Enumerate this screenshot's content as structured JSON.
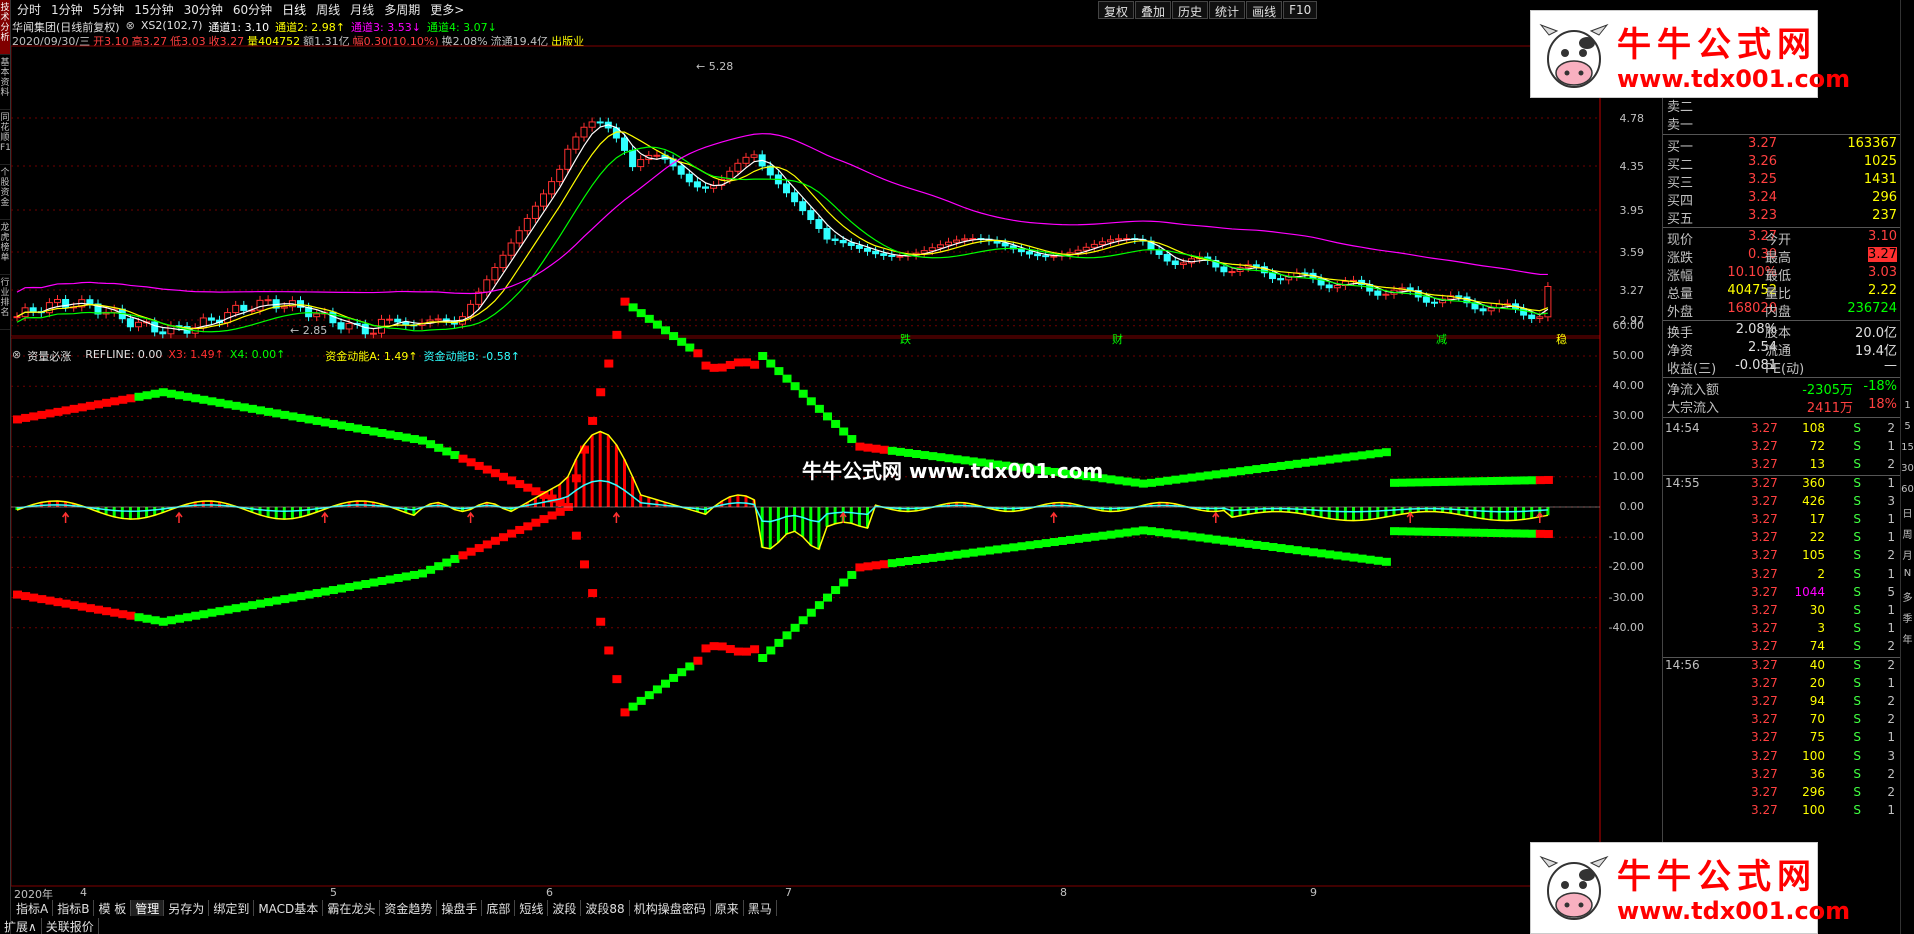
{
  "toolbar": {
    "tabs": [
      "分时",
      "1分钟",
      "5分钟",
      "15分钟",
      "30分钟",
      "60分钟",
      "日线",
      "周线",
      "月线",
      "多周期",
      "更多>"
    ],
    "right_buttons": [
      "复权",
      "叠加",
      "历史",
      "统计",
      "画线",
      "F10"
    ]
  },
  "left_tabs": [
    "技术分析",
    "基本资料",
    "同花顺F10",
    "个股资金",
    "龙虎榜单",
    "行业排名"
  ],
  "main_info": {
    "stock": "华闻集团(日线前复权)",
    "indicator": "XS2(102,7)",
    "ch1": "通道1: 3.10",
    "ch2": "通道2: 2.98↑",
    "ch3": "通道3: 3.53↓",
    "ch4": "通道4: 3.07↓"
  },
  "ohlc_line": {
    "date": "2020/09/30/三",
    "open": "开3.10",
    "high": "高3.27",
    "low": "低3.03",
    "close": "收3.27",
    "vol": "量404752",
    "amount": "额1.31亿",
    "change": "幅0.30(10.10%)",
    "turnover": "换2.08%",
    "float": "流通19.4亿",
    "industry": "出版业"
  },
  "price_axis": [
    "4.78",
    "4.35",
    "3.95",
    "3.59",
    "3.27",
    "2.97"
  ],
  "price_marks": {
    "high": "5.28",
    "low": "2.85"
  },
  "event_marks": [
    "跌",
    "财",
    "减",
    "稳"
  ],
  "sub_info": {
    "name": "资量必涨",
    "refline": "REFLINE: 0.00",
    "x3": "X3: 1.49↑",
    "x4": "X4: 0.00↑",
    "a": "资金动能A: 1.49↑",
    "b": "资金动能B: -0.58↑"
  },
  "sub_axis": [
    "60.00",
    "50.00",
    "40.00",
    "30.00",
    "20.00",
    "10.00",
    "0.00",
    "-10.00",
    "-20.00",
    "-30.00",
    "-40.00"
  ],
  "date_axis": [
    "2020年",
    "4",
    "5",
    "6",
    "7",
    "8",
    "9"
  ],
  "center_watermark": "牛牛公式网 www.tdx001.com",
  "watermark": {
    "title": "牛牛公式网",
    "url": "www.tdx001.com"
  },
  "quote": {
    "asks": [
      [
        "卖二",
        "",
        ""
      ],
      [
        "卖二",
        "",
        ""
      ],
      [
        "卖一",
        "",
        ""
      ]
    ],
    "bids": [
      [
        "买一",
        "3.27",
        "163367"
      ],
      [
        "买二",
        "3.26",
        "1025"
      ],
      [
        "买三",
        "3.25",
        "1431"
      ],
      [
        "买四",
        "3.24",
        "296"
      ],
      [
        "买五",
        "3.23",
        "237"
      ]
    ],
    "stats": [
      [
        "现价",
        "3.27",
        "今开",
        "3.10"
      ],
      [
        "涨跌",
        "0.30",
        "最高",
        "3.27"
      ],
      [
        "涨幅",
        "10.10%",
        "最低",
        "3.03"
      ],
      [
        "总量",
        "404752",
        "量比",
        "2.22"
      ],
      [
        "外盘",
        "168020",
        "内盘",
        "236724"
      ]
    ],
    "stats2": [
      [
        "换手",
        "2.08%",
        "股本",
        "20.0亿"
      ],
      [
        "净资",
        "2.54",
        "流通",
        "19.4亿"
      ],
      [
        "收益(三)",
        "-0.081",
        "PE(动)",
        "—"
      ]
    ],
    "flows": [
      [
        "净流入额",
        "-2305万",
        "-18%"
      ],
      [
        "大宗流入",
        "2411万",
        "18%"
      ]
    ]
  },
  "ticks": [
    [
      "14:54",
      "3.27",
      "108",
      "S",
      "2"
    ],
    [
      "",
      "3.27",
      "72",
      "S",
      "1"
    ],
    [
      "",
      "3.27",
      "13",
      "S",
      "2"
    ],
    [
      "14:55",
      "3.27",
      "360",
      "S",
      "1"
    ],
    [
      "",
      "3.27",
      "426",
      "S",
      "3"
    ],
    [
      "",
      "3.27",
      "17",
      "S",
      "1"
    ],
    [
      "",
      "3.27",
      "22",
      "S",
      "1"
    ],
    [
      "",
      "3.27",
      "105",
      "S",
      "2"
    ],
    [
      "",
      "3.27",
      "2",
      "S",
      "1"
    ],
    [
      "",
      "3.27",
      "1044",
      "S",
      "5"
    ],
    [
      "",
      "3.27",
      "30",
      "S",
      "1"
    ],
    [
      "",
      "3.27",
      "3",
      "S",
      "1"
    ],
    [
      "",
      "3.27",
      "74",
      "S",
      "2"
    ],
    [
      "14:56",
      "3.27",
      "40",
      "S",
      "2"
    ],
    [
      "",
      "3.27",
      "20",
      "S",
      "1"
    ],
    [
      "",
      "3.27",
      "94",
      "S",
      "2"
    ],
    [
      "",
      "3.27",
      "70",
      "S",
      "2"
    ],
    [
      "",
      "3.27",
      "75",
      "S",
      "1"
    ],
    [
      "",
      "3.27",
      "100",
      "S",
      "3"
    ],
    [
      "",
      "3.27",
      "36",
      "S",
      "2"
    ],
    [
      "",
      "3.27",
      "296",
      "S",
      "2"
    ],
    [
      "",
      "3.27",
      "100",
      "S",
      "1"
    ]
  ],
  "right_side": [
    "1",
    "5",
    "15",
    "30",
    "60",
    "日",
    "周",
    "月",
    "N",
    "多",
    "季",
    "年"
  ],
  "bottom_tabs": [
    "指标A",
    "指标B",
    "模 板",
    "管理",
    "另存为",
    "绑定到",
    "MACD基本",
    "霸在龙头",
    "资金趋势",
    "操盘手",
    "底部",
    "短线",
    "波段",
    "波段88",
    "机构操盘密码",
    "原来",
    "黑马"
  ],
  "bottom_tabs2": [
    "扩展∧",
    "关联报价"
  ],
  "colors": {
    "up": "#ff3030",
    "down": "#30ffff",
    "green": "#00ff00",
    "red": "#ff0000",
    "yellow": "#ffff00",
    "magenta": "#ff00ff"
  }
}
